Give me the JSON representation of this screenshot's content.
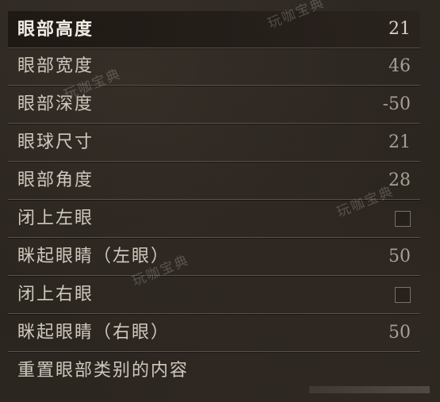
{
  "menu": {
    "rows": [
      {
        "label": "眼部高度",
        "value": "21"
      },
      {
        "label": "眼部宽度",
        "value": "46"
      },
      {
        "label": "眼部深度",
        "value": "-50"
      },
      {
        "label": "眼球尺寸",
        "value": "21"
      },
      {
        "label": "眼部角度",
        "value": "28"
      },
      {
        "label": "闭上左眼",
        "checked": false
      },
      {
        "label": "眯起眼睛（左眼）",
        "value": "50"
      },
      {
        "label": "闭上右眼",
        "checked": false
      },
      {
        "label": "眯起眼睛（右眼）",
        "value": "50"
      },
      {
        "label": "重置眼部类别的内容"
      }
    ]
  },
  "watermark": {
    "text": "玩咖宝典"
  }
}
